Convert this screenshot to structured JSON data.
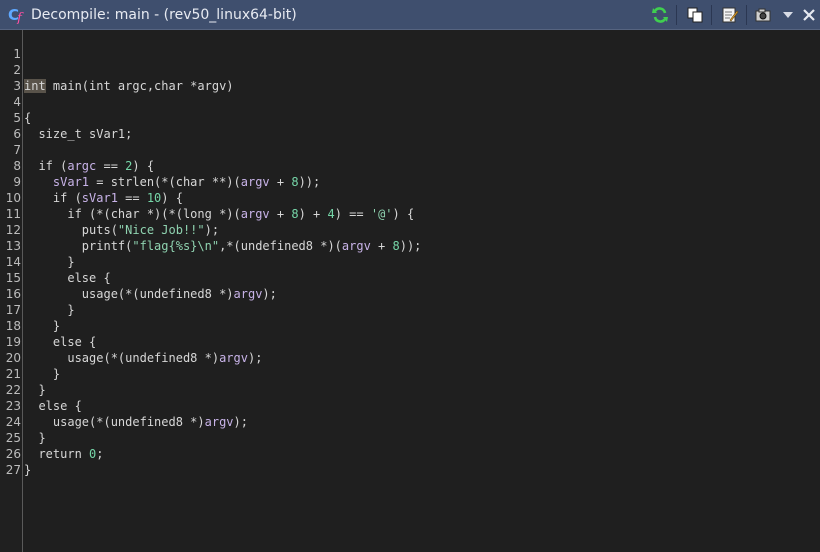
{
  "window": {
    "title": "Decompile: main -  (rev50_linux64-bit)",
    "app_icon": "decompile-icon",
    "toolbar": {
      "icons": [
        "refresh-icon",
        "copy-icon",
        "edit-icon",
        "snapshot-icon",
        "dropdown-menu-icon",
        "close-icon"
      ]
    }
  },
  "colors": {
    "title_bar": "#3f4f6e",
    "editor_bg": "#1f1f1f",
    "number": "#76d6a8",
    "variable": "#c8b3e8",
    "highlight": "#59534a"
  },
  "code": {
    "line_numbers": [
      "1",
      "2",
      "3",
      "4",
      "5",
      "6",
      "7",
      "8",
      "9",
      "10",
      "11",
      "12",
      "13",
      "14",
      "15",
      "16",
      "17",
      "18",
      "19",
      "20",
      "21",
      "22",
      "23",
      "24",
      "25",
      "26",
      "27"
    ],
    "tokens": {
      "l2_type": "int",
      "l2_rest": " main(int argc,char *argv)",
      "l4": "{",
      "l5": "  size_t sVar1;",
      "l7_a": "  if (",
      "l7_var": "argc",
      "l7_b": " == ",
      "l7_num": "2",
      "l7_c": ") {",
      "l8_a": "    sVar1",
      "l8_b": " = strlen(*(char **)(",
      "l8_var": "argv",
      "l8_c": " + ",
      "l8_num": "8",
      "l8_d": "));",
      "l9_a": "    if (",
      "l9_var": "sVar1",
      "l9_b": " == ",
      "l9_num": "10",
      "l9_c": ") {",
      "l10_a": "      if (*(char *)(*(long *)(",
      "l10_var": "argv",
      "l10_b": " + ",
      "l10_num1": "8",
      "l10_c": ") + ",
      "l10_num2": "4",
      "l10_d": ") == ",
      "l10_str": "'@'",
      "l10_e": ") {",
      "l11_a": "        puts(",
      "l11_str": "\"Nice Job!!\"",
      "l11_b": ");",
      "l12_a": "        printf(",
      "l12_str": "\"flag{%s}\\n\"",
      "l12_b": ",*(undefined8 *)(",
      "l12_var": "argv",
      "l12_c": " + ",
      "l12_num": "8",
      "l12_d": "));",
      "l13": "      }",
      "l14": "      else {",
      "l15_a": "        usage(*(undefined8 *)",
      "l15_var": "argv",
      "l15_b": ");",
      "l16": "      }",
      "l17": "    }",
      "l18": "    else {",
      "l19_a": "      usage(*(undefined8 *)",
      "l19_var": "argv",
      "l19_b": ");",
      "l20": "    }",
      "l21": "  }",
      "l22": "  else {",
      "l23_a": "    usage(*(undefined8 *)",
      "l23_var": "argv",
      "l23_b": ");",
      "l24": "  }",
      "l25_a": "  return ",
      "l25_num": "0",
      "l25_b": ";",
      "l26": "}"
    }
  }
}
